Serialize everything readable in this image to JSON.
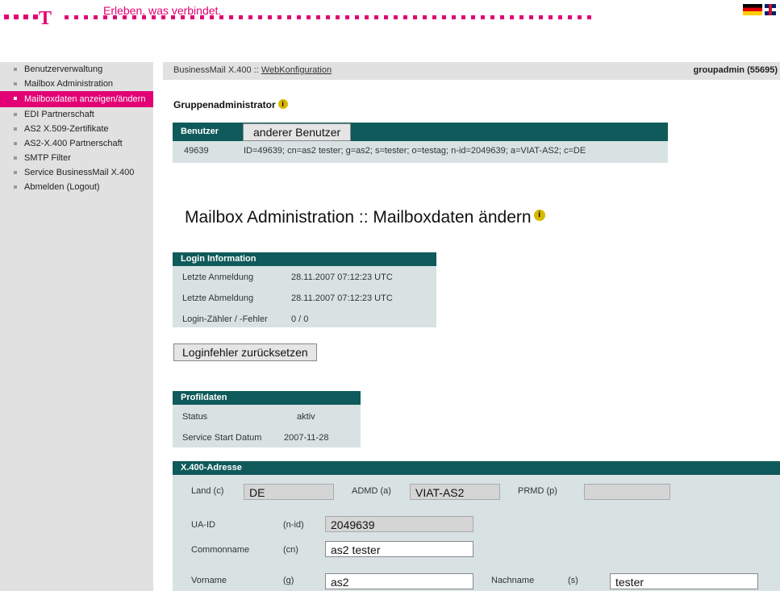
{
  "header": {
    "logo": "T",
    "tagline": "Erleben, was verbindet."
  },
  "sidebar": {
    "items": [
      {
        "label": "Benutzerverwaltung"
      },
      {
        "label": "Mailbox Administration"
      },
      {
        "label": "Mailboxdaten anzeigen/ändern"
      },
      {
        "label": "EDI Partnerschaft"
      },
      {
        "label": "AS2 X.509-Zertifikate"
      },
      {
        "label": "AS2-X.400 Partnerschaft"
      },
      {
        "label": "SMTP Filter"
      },
      {
        "label": "Service BusinessMail X.400"
      },
      {
        "label": "Abmelden (Logout)"
      }
    ],
    "active_index": 2
  },
  "topbar": {
    "crumb_prefix": "BusinessMail X.400 :: ",
    "crumb_link": "WebKonfiguration",
    "user": "groupadmin (55695)"
  },
  "group": {
    "title": "Gruppenadministrator",
    "panel_label": "Benutzer",
    "other_user_button": "anderer Benutzer",
    "user_id": "49639",
    "user_dn": "ID=49639; cn=as2 tester; g=as2; s=tester; o=testag; n-id=2049639; a=VIAT-AS2; c=DE"
  },
  "page_title": "Mailbox Administration :: Mailboxdaten ändern",
  "login_info": {
    "title": "Login Information",
    "rows": [
      {
        "label": "Letzte Anmeldung",
        "value": "28.11.2007 07:12:23 UTC"
      },
      {
        "label": "Letzte Abmeldung",
        "value": "28.11.2007 07:12:23 UTC"
      },
      {
        "label": "Login-Zähler / -Fehler",
        "value": "0 / 0"
      }
    ],
    "reset_button": "Loginfehler zurücksetzen"
  },
  "profile": {
    "title": "Profildaten",
    "rows": [
      {
        "label": "Status",
        "value": "aktiv"
      },
      {
        "label": "Service Start Datum",
        "value": "2007-11-28"
      }
    ]
  },
  "x400": {
    "title": "X.400-Adresse",
    "land_label": "Land (c)",
    "land_value": "DE",
    "admd_label": "ADMD (a)",
    "admd_value": "VIAT-AS2",
    "prmd_label": "PRMD (p)",
    "prmd_value": "",
    "uaid_label": "UA-ID",
    "uaid_code": "(n-id)",
    "uaid_value": "2049639",
    "cn_label": "Commonname",
    "cn_code": "(cn)",
    "cn_value": "as2 tester",
    "vorname_label": "Vorname",
    "vorname_code": "(g)",
    "vorname_value": "as2",
    "nachname_label": "Nachname",
    "nachname_code": "(s)",
    "nachname_value": "tester"
  }
}
